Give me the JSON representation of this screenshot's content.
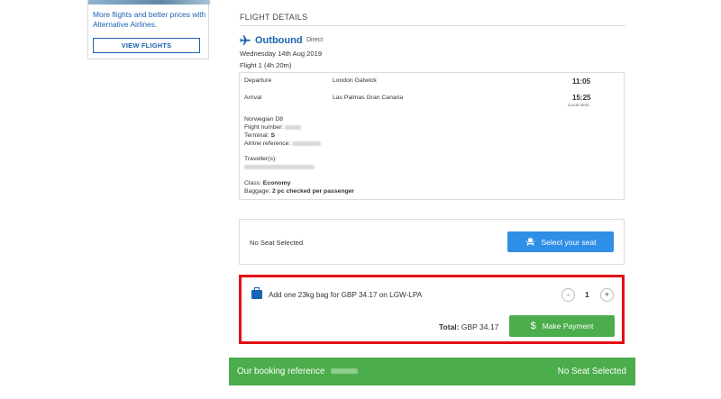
{
  "colors": {
    "brand_blue": "#1a62b3",
    "seat_button": "#2f8fe6",
    "pay_green": "#4bad4b",
    "highlight_red": "#e30f13"
  },
  "promo": {
    "text": "More flights and better prices with Alternative Airlines.",
    "button_label": "VIEW FLIGHTS"
  },
  "flight_details": {
    "title": "FLIGHT DETAILS",
    "direction_icon": "plane-icon",
    "direction": "Outbound",
    "type": "Direct",
    "date": "Wednesday 14th Aug 2019",
    "flight_info": "Flight 1 (4h 20m)",
    "departure": {
      "label": "Departure",
      "airport": "London Gatwick",
      "time": "11:05"
    },
    "arrival": {
      "label": "Arrival",
      "airport": "Las Palmas Gran Canaria",
      "time": "15:25",
      "note": "(Local time)"
    },
    "airline": "Norwegian D8",
    "flight_number_label": "Flight number:",
    "terminal_label": "Terminal:",
    "terminal_value": "S",
    "airline_reference_label": "Airline reference:",
    "travellers_label": "Traveller(s):",
    "class_label": "Class:",
    "class_value": "Economy",
    "baggage_label": "Baggage:",
    "baggage_value": "2 pc checked per passenger"
  },
  "seat": {
    "status": "No Seat Selected",
    "button_label": "Select your seat",
    "button_icon": "seat-icon"
  },
  "bag": {
    "icon": "briefcase-icon",
    "text": "Add one 23kg bag for GBP 34.17 on LGW-LPA",
    "minus": "-",
    "quantity": "1",
    "plus": "+",
    "total_label": "Total:",
    "total_value": "GBP 34.17",
    "pay_button_label": "Make Payment",
    "pay_icon": "dollar-icon"
  },
  "footer": {
    "booking_reference_label": "Our booking reference",
    "seat_status": "No Seat Selected"
  }
}
